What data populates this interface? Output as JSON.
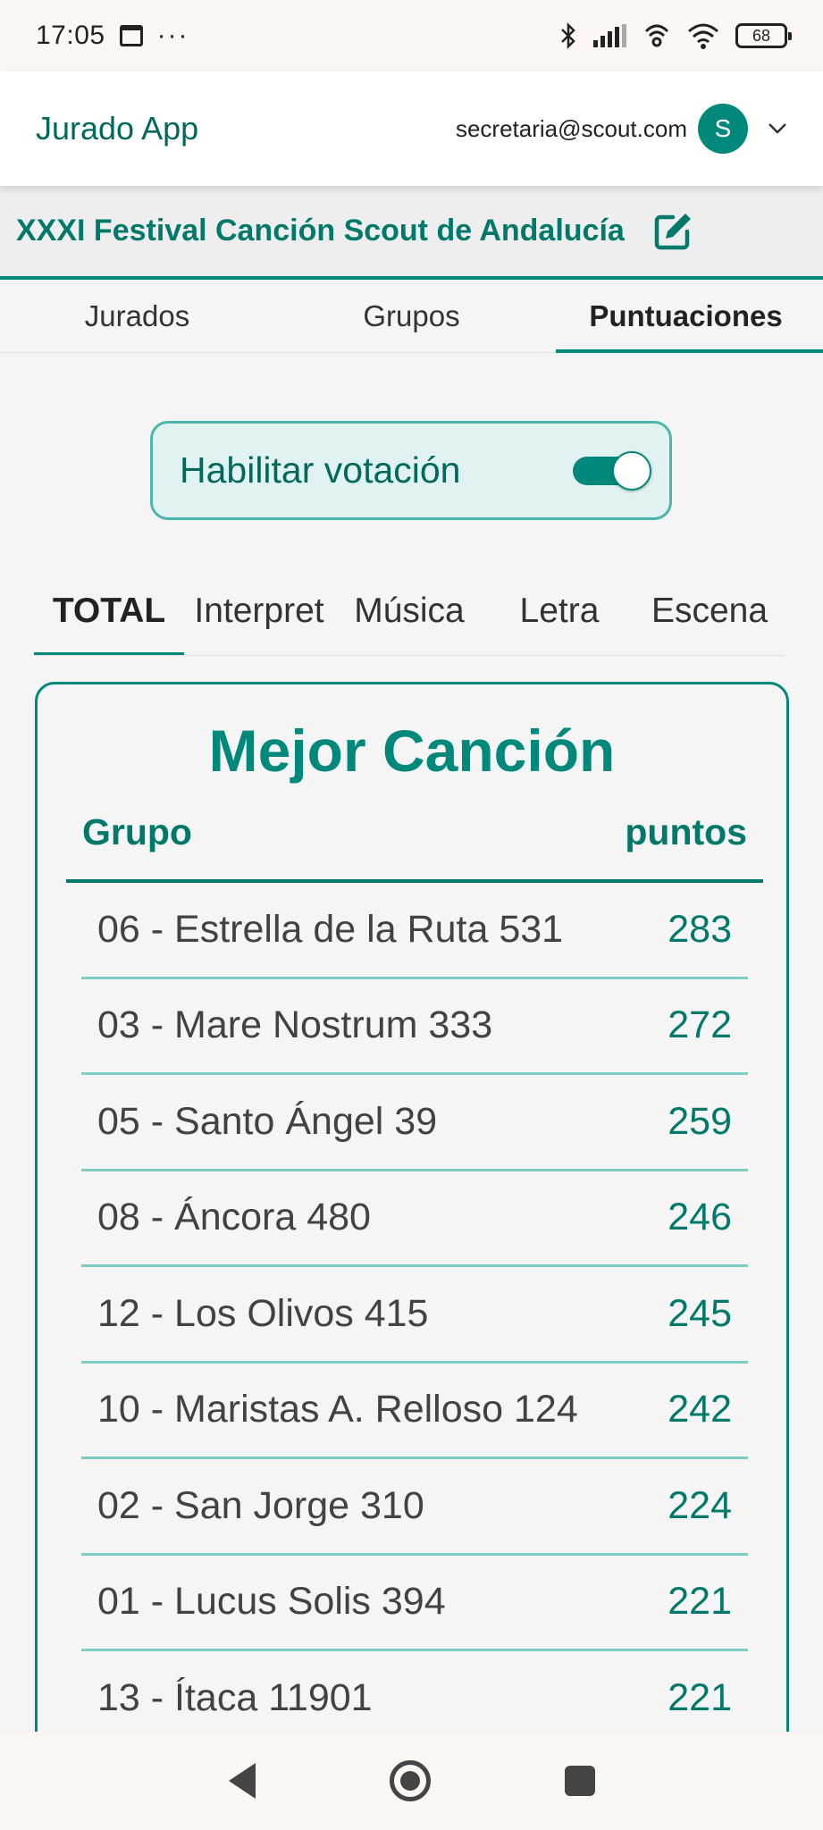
{
  "status_bar": {
    "time": "17:05",
    "more": "···",
    "battery": "68"
  },
  "app_bar": {
    "title": "Jurado App",
    "user_email": "secretaria@scout.com",
    "avatar_initial": "S"
  },
  "festival": {
    "name": "XXXI Festival Canción Scout de Andalucía"
  },
  "main_tabs": [
    {
      "label": "Jurados",
      "active": false
    },
    {
      "label": "Grupos",
      "active": false
    },
    {
      "label": "Puntuaciones",
      "active": true
    }
  ],
  "voting_toggle": {
    "label": "Habilitar votación",
    "enabled": true
  },
  "category_tabs": [
    {
      "label": "TOTAL",
      "active": true
    },
    {
      "label": "Interpret",
      "active": false
    },
    {
      "label": "Música",
      "active": false
    },
    {
      "label": "Letra",
      "active": false
    },
    {
      "label": "Escena",
      "active": false
    }
  ],
  "ranking": {
    "title": "Mejor Canción",
    "col_group": "Grupo",
    "col_points": "puntos",
    "rows": [
      {
        "group": "06 - Estrella de la Ruta 531",
        "points": "283"
      },
      {
        "group": "03 - Mare Nostrum 333",
        "points": "272"
      },
      {
        "group": "05 - Santo Ángel 39",
        "points": "259"
      },
      {
        "group": "08 - Áncora 480",
        "points": "246"
      },
      {
        "group": "12 - Los Olivos 415",
        "points": "245"
      },
      {
        "group": "10 - Maristas A. Relloso 124",
        "points": "242"
      },
      {
        "group": "02 - San Jorge 310",
        "points": "224"
      },
      {
        "group": "01 - Lucus Solis 394",
        "points": "221"
      },
      {
        "group": "13 - Ítaca 11901",
        "points": "221"
      }
    ]
  },
  "colors": {
    "accent": "#00897b",
    "accent_dark": "#00695c",
    "row_divider": "#80cbc4"
  }
}
